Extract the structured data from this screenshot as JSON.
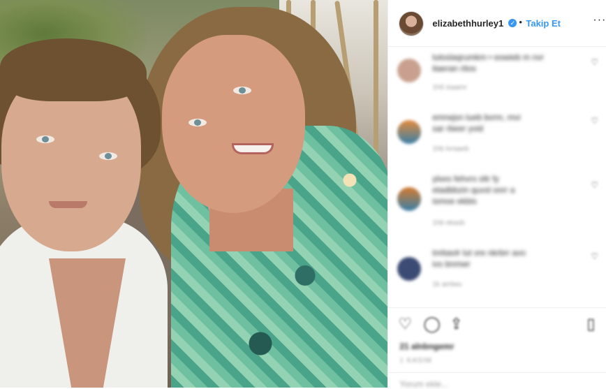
{
  "photo": {
    "description_icon": "post-photo"
  },
  "header": {
    "username": "elizabethhurley1",
    "verified_icon": "verified-badge-icon",
    "separator": "•",
    "follow_label": "Takip Et",
    "more_icon": "more-options-icon",
    "more_label": "···"
  },
  "comments": [
    {
      "text1": "lutsslaqrumkm • eowieb m nvr",
      "text2": "itaeran ritos",
      "meta": "1h6    isaamr",
      "avatar_color": "#c9a08f"
    },
    {
      "text1": "emrwjsn lueb bvrm, mvi",
      "text2": "sar rbeer yvid",
      "meta": "1hb    lvraaeb",
      "avatar_color": "#e58a3a"
    },
    {
      "text1": "ylxes fehvrs sltr fy",
      "text2": "etadbbzin quvsl onrr a",
      "text3": "ismoe ekbis",
      "meta": "1hb    ekasb",
      "avatar_color": "#d67a2e"
    },
    {
      "text1": "tnrbavlr lut vre nkrbrr avo",
      "text2": "ivs bnmwr",
      "meta": "1k    amlwu",
      "avatar_color": "#3b4b73"
    }
  ],
  "actions": {
    "like_icon": "heart-icon",
    "comment_icon": "comment-icon",
    "share_icon": "share-icon",
    "save_icon": "bookmark-icon",
    "likes_text": "21 alnbngemr",
    "date_text": "1 KASIM",
    "add_comment": "Yorum ekle..."
  },
  "colors": {
    "accent": "#3897f0",
    "text": "#262626",
    "muted": "#999999",
    "border": "#efefef"
  }
}
